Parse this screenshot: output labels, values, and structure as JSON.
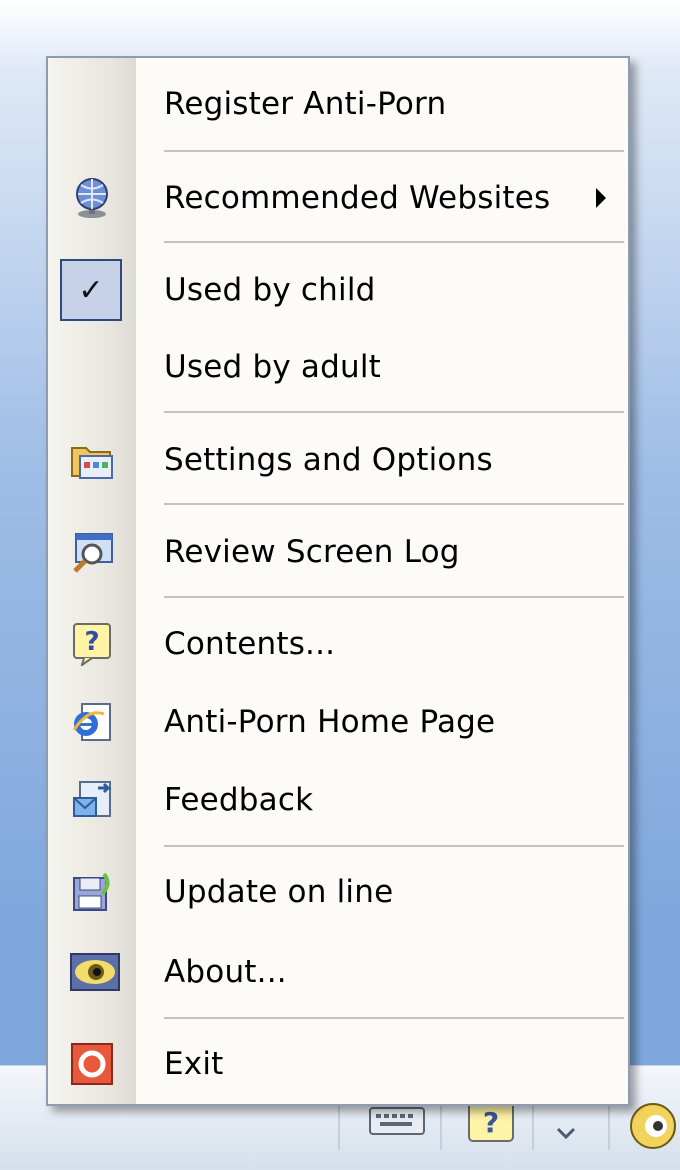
{
  "menu": {
    "items": [
      {
        "label": "Register Anti-Porn",
        "icon": "none"
      },
      {
        "label": "Recommended Websites",
        "icon": "globe-network-icon",
        "submenu": true
      },
      {
        "label": "Used by child",
        "icon": "checkmark-icon",
        "checked": true
      },
      {
        "label": "Used by adult",
        "icon": "none"
      },
      {
        "label": "Settings and Options",
        "icon": "folder-settings-icon"
      },
      {
        "label": "Review Screen Log",
        "icon": "screen-log-magnifier-icon"
      },
      {
        "label": "Contents...",
        "icon": "help-question-icon"
      },
      {
        "label": "Anti-Porn Home Page",
        "icon": "internet-explorer-icon"
      },
      {
        "label": "Feedback",
        "icon": "feedback-mail-icon"
      },
      {
        "label": "Update on line",
        "icon": "update-disk-icon"
      },
      {
        "label": "About...",
        "icon": "eye-icon"
      },
      {
        "label": "Exit",
        "icon": "exit-power-icon"
      }
    ]
  },
  "taskbar": {
    "tray_icons": [
      "keyboard-icon",
      "help-icon",
      "chevron-down-icon",
      "eye-tray-icon"
    ]
  },
  "colors": {
    "menu_bg": "#fcfbf8",
    "gutter": "#e8e6df",
    "check_border": "#2c4a7c",
    "check_fill": "#c7d2e8",
    "desktop": "#7ea7dc"
  }
}
